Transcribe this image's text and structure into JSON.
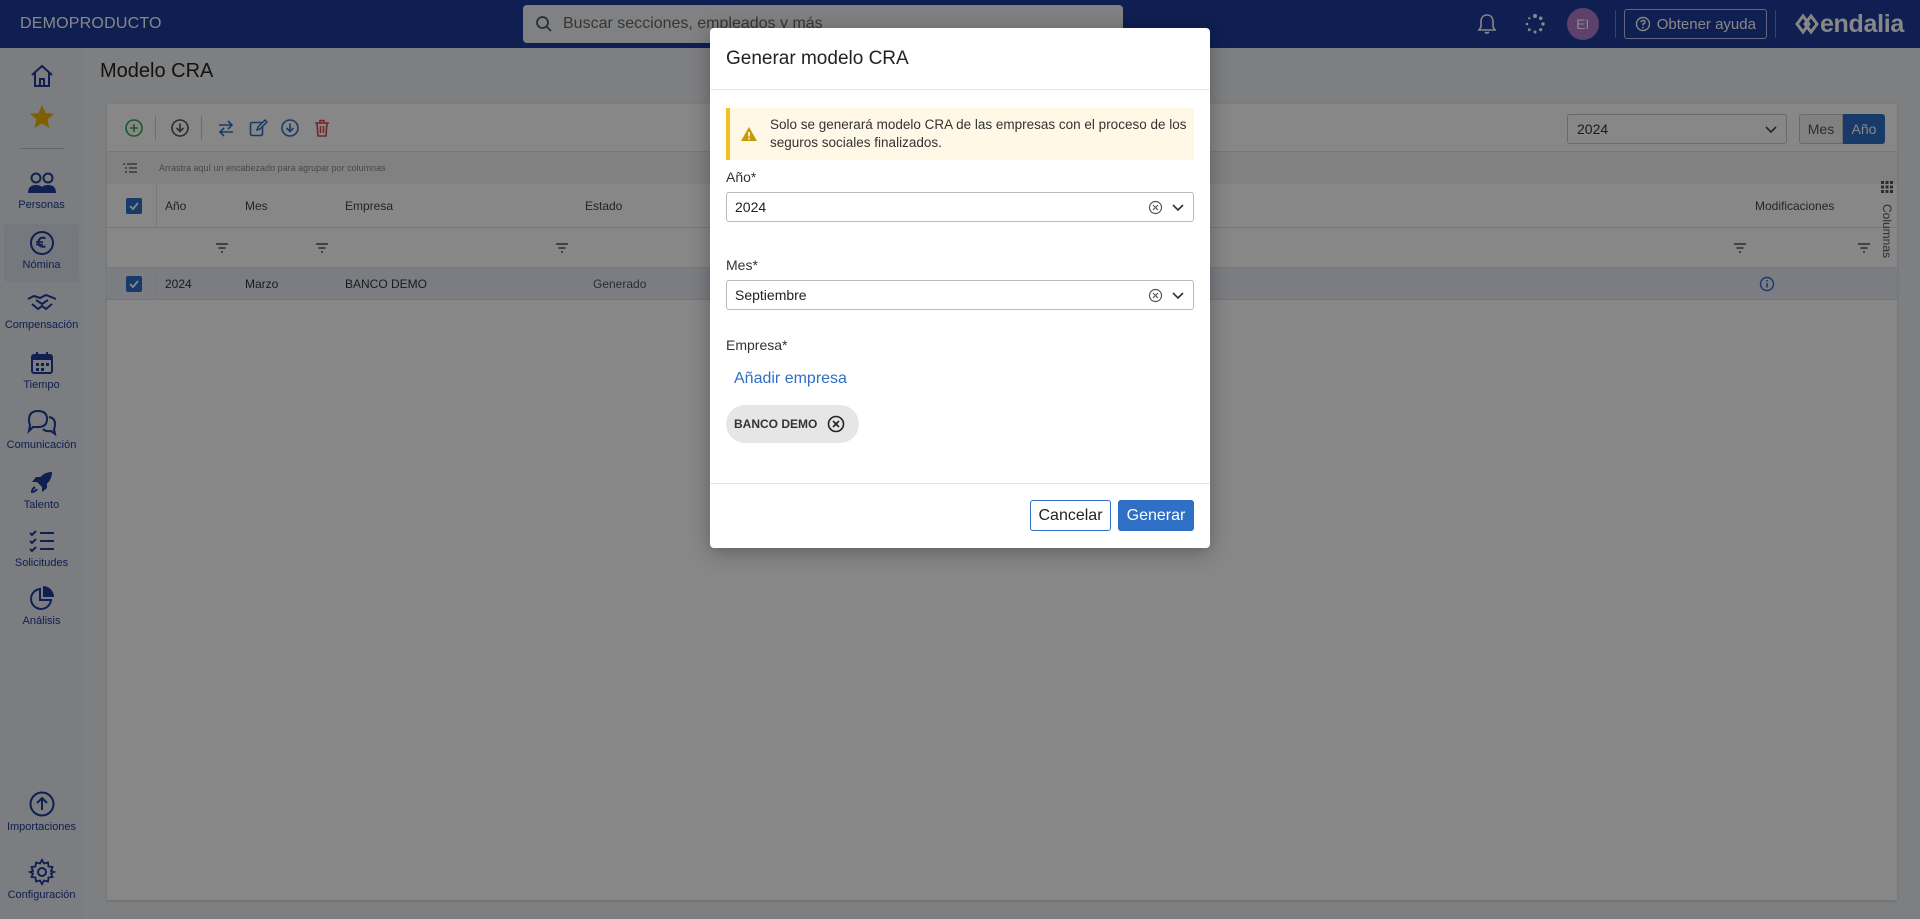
{
  "app": {
    "brand": "DEMOPRODUCTO",
    "search_placeholder": "Buscar secciones, empleados y más",
    "avatar_initials": "EI",
    "help_label": "Obtener ayuda",
    "logo_text": "endalia"
  },
  "sidebar": {
    "items": [
      {
        "label": "Personas"
      },
      {
        "label": "Nómina"
      },
      {
        "label": "Compensación"
      },
      {
        "label": "Tiempo"
      },
      {
        "label": "Comunicación"
      },
      {
        "label": "Talento"
      },
      {
        "label": "Solicitudes"
      },
      {
        "label": "Análisis"
      },
      {
        "label": "Importaciones"
      },
      {
        "label": "Configuración"
      }
    ]
  },
  "page": {
    "title": "Modelo CRA",
    "year_select": "2024",
    "period_mes": "Mes",
    "period_ano": "Año",
    "group_hint": "Arrastra aquí un encabezado para agrupar por columnas",
    "columns_tab": "Columnas",
    "grid": {
      "headers": {
        "ano": "Año",
        "mes": "Mes",
        "empresa": "Empresa",
        "estado": "Estado",
        "modificaciones": "Modificaciones"
      },
      "rows": [
        {
          "ano": "2024",
          "mes": "Marzo",
          "empresa": "BANCO DEMO",
          "estado": "Generado"
        }
      ]
    }
  },
  "modal": {
    "title": "Generar modelo CRA",
    "warning": "Solo se generará modelo CRA de las empresas con el proceso de los seguros sociales finalizados.",
    "year_label": "Año*",
    "year_value": "2024",
    "month_label": "Mes*",
    "month_value": "Septiembre",
    "company_label": "Empresa*",
    "add_company": "Añadir empresa",
    "chip": "BANCO DEMO",
    "cancel": "Cancelar",
    "generate": "Generar"
  },
  "colors": {
    "topbar": "#1e3c9a",
    "accent": "#2f6fc6",
    "warning_border": "#f2c125",
    "delete": "#e04343",
    "add": "#3aa64c"
  }
}
